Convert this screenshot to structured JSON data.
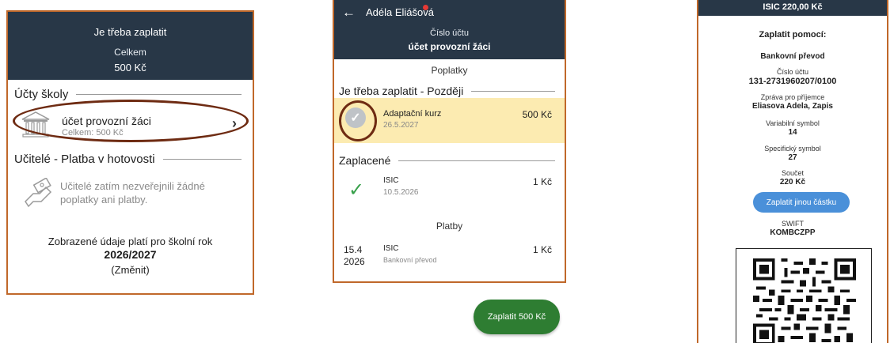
{
  "panel1": {
    "header": {
      "title": "Je třeba zaplatit",
      "total_label": "Celkem",
      "total_value": "500 Kč"
    },
    "section_accounts": "Účty školy",
    "account": {
      "name": "účet provozní žáci",
      "sub": "Celkem: 500 Kč",
      "chevron": "›",
      "icon": "bank-icon"
    },
    "section_teachers": "Učitelé - Platba v hotovosti",
    "teachers_info": "Učitelé zatím nezveřejnili žádné poplatky ani platby.",
    "footer": {
      "line1": "Zobrazené údaje platí pro školní rok",
      "year": "2026/2027",
      "change": "(Změnit)"
    }
  },
  "panel2": {
    "header": {
      "back": "←",
      "user": "Adéla Eliášová",
      "label": "Číslo účtu",
      "account": "účet provozní žáci"
    },
    "fees_title": "Poplatky",
    "section_later": "Je třeba zaplatit - Později",
    "pending_item": {
      "name": "Adaptační kurz",
      "date": "26.5.2027",
      "amount": "500 Kč"
    },
    "section_paid": "Zaplacené",
    "paid_item": {
      "name": "ISIC",
      "date": "10.5.2026",
      "amount": "1 Kč"
    },
    "payments_title": "Platby",
    "payment_item": {
      "day": "15.4",
      "year": "2026",
      "name": "ISIC",
      "method": "Bankovní převod",
      "amount": "1 Kč"
    },
    "pay_button": "Zaplatit 500 Kč"
  },
  "panel3": {
    "header": "ISIC 220,00 Kč",
    "pay_with": "Zaplatit pomocí:",
    "method": "Bankovní převod",
    "account_label": "Číslo účtu",
    "account_value": "131-2731960207/0100",
    "message_label": "Zpráva pro příjemce",
    "message_value": "Eliasova Adela, Zapis",
    "vs_label": "Variabilní symbol",
    "vs_value": "14",
    "ss_label": "Specifický symbol",
    "ss_value": "27",
    "sum_label": "Součet",
    "sum_value": "220 Kč",
    "other_amount_button": "Zaplatit jinou částku",
    "swift_label": "SWIFT",
    "swift_value": "KOMBCZPP"
  },
  "colors": {
    "header": "#283747",
    "accent_border": "#c0682a",
    "annotation": "#6e2b12",
    "highlight": "#fcebb1",
    "pay_green": "#2e7d32",
    "button_blue": "#4a90d9",
    "check_green": "#37a04a"
  }
}
